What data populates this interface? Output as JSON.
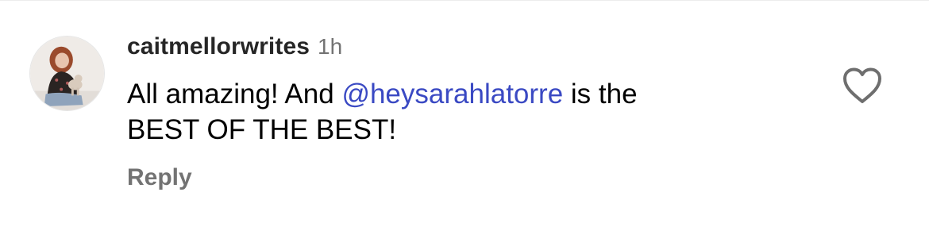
{
  "comment": {
    "username": "caitmellorwrites",
    "timestamp": "1h",
    "text_before": "All amazing! And ",
    "mention": "@heysarahlatorre",
    "text_after": " is the",
    "text_line2": "BEST OF THE BEST!",
    "reply_label": "Reply",
    "like_icon": "heart-outline-icon"
  },
  "colors": {
    "mention": "#3a49c3",
    "secondary_text": "#737373",
    "username": "#262626"
  }
}
